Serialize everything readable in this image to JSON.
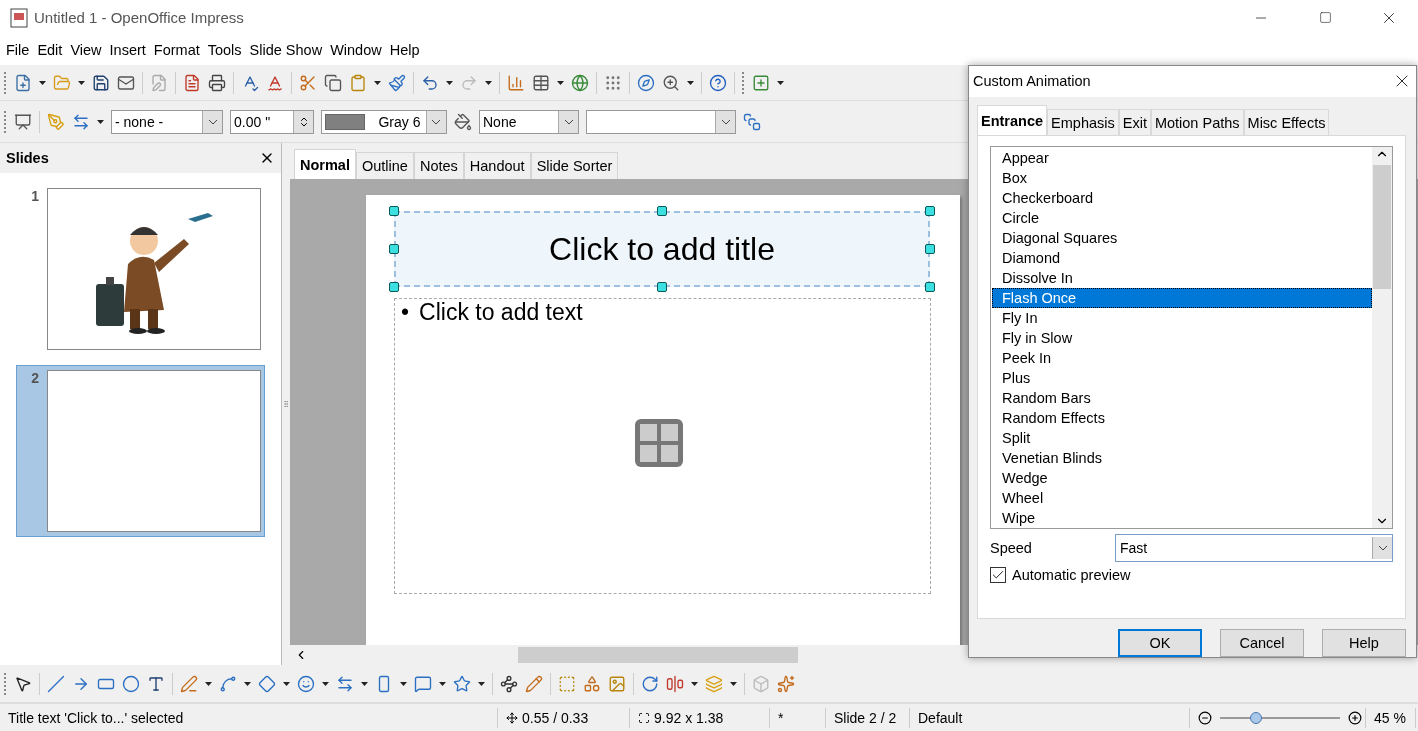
{
  "window": {
    "title": "Untitled 1 - OpenOffice Impress"
  },
  "menu": [
    "File",
    "Edit",
    "View",
    "Insert",
    "Format",
    "Tools",
    "Slide Show",
    "Window",
    "Help"
  ],
  "format_bar": {
    "line_style": "- none -",
    "line_width": "0.00 \"",
    "line_color": "Gray 6",
    "area_style": "None"
  },
  "slides_pane": {
    "title": "Slides",
    "slides": [
      {
        "number": "1",
        "selected": false,
        "kind": "picture"
      },
      {
        "number": "2",
        "selected": true,
        "kind": "blank"
      }
    ]
  },
  "view_tabs": [
    {
      "label": "Normal",
      "selected": true
    },
    {
      "label": "Outline",
      "selected": false
    },
    {
      "label": "Notes",
      "selected": false
    },
    {
      "label": "Handout",
      "selected": false
    },
    {
      "label": "Slide Sorter",
      "selected": false
    }
  ],
  "slide": {
    "title_placeholder": "Click to add title",
    "bullet": "•",
    "text_placeholder": "Click to add text"
  },
  "dialog": {
    "title": "Custom Animation",
    "tabs": [
      {
        "label": "Entrance",
        "selected": true
      },
      {
        "label": "Emphasis",
        "selected": false
      },
      {
        "label": "Exit",
        "selected": false
      },
      {
        "label": "Motion Paths",
        "selected": false
      },
      {
        "label": "Misc Effects",
        "selected": false
      }
    ],
    "effects": [
      {
        "label": "Appear",
        "selected": false
      },
      {
        "label": "Box",
        "selected": false
      },
      {
        "label": "Checkerboard",
        "selected": false
      },
      {
        "label": "Circle",
        "selected": false
      },
      {
        "label": "Diagonal Squares",
        "selected": false
      },
      {
        "label": "Diamond",
        "selected": false
      },
      {
        "label": "Dissolve In",
        "selected": false
      },
      {
        "label": "Flash Once",
        "selected": true
      },
      {
        "label": "Fly In",
        "selected": false
      },
      {
        "label": "Fly in Slow",
        "selected": false
      },
      {
        "label": "Peek In",
        "selected": false
      },
      {
        "label": "Plus",
        "selected": false
      },
      {
        "label": "Random Bars",
        "selected": false
      },
      {
        "label": "Random Effects",
        "selected": false
      },
      {
        "label": "Split",
        "selected": false
      },
      {
        "label": "Venetian Blinds",
        "selected": false
      },
      {
        "label": "Wedge",
        "selected": false
      },
      {
        "label": "Wheel",
        "selected": false
      },
      {
        "label": "Wipe",
        "selected": false
      }
    ],
    "speed_label": "Speed",
    "speed": "Fast",
    "automatic_preview": {
      "label": "Automatic preview",
      "checked": true
    },
    "buttons": [
      {
        "label": "OK",
        "default": true
      },
      {
        "label": "Cancel",
        "default": false
      },
      {
        "label": "Help",
        "default": false
      }
    ]
  },
  "status_bar": {
    "message": "Title text 'Click to...' selected",
    "position": "0.55 / 0.33",
    "size": "9.92 x 1.38",
    "modified": "*",
    "slide": "Slide 2 / 2",
    "layout": "Default",
    "zoom": {
      "level": 0.3
    },
    "zoom_label": "45 %"
  }
}
